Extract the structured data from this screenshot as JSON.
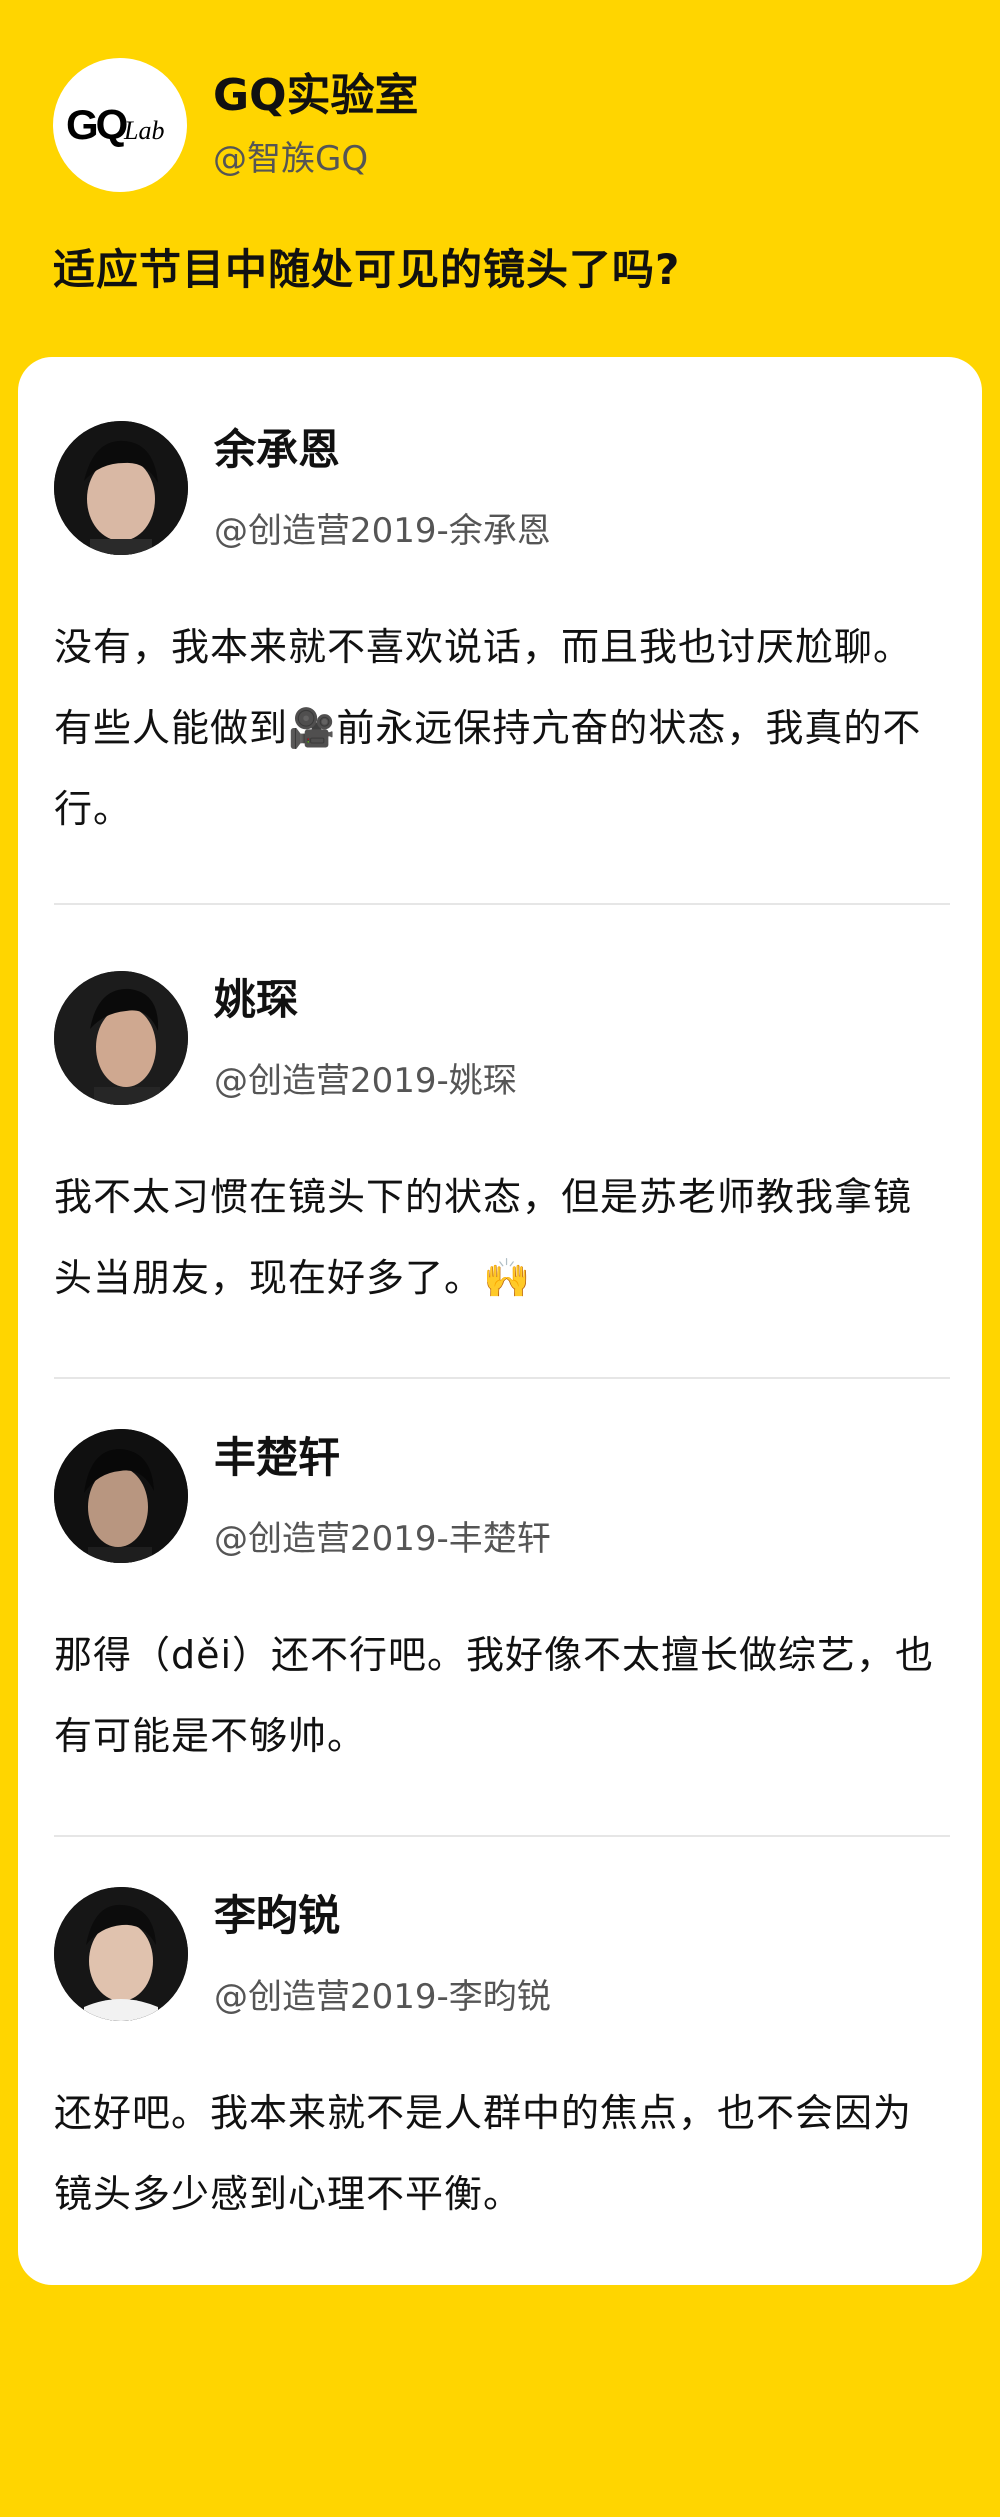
{
  "brand": {
    "logo_text": "GQLab",
    "name": "GQ实验室",
    "handle": "@智族GQ"
  },
  "question": "适应节目中随处可见的镜头了吗?",
  "entries": [
    {
      "name": "余承恩",
      "handle": "@创造营2019-余承恩",
      "answer": "没有，我本来就不喜欢说话，而且我也讨厌尬聊。有些人能做到🎥前永远保持亢奋的状态，我真的不行。"
    },
    {
      "name": "姚琛",
      "handle": "@创造营2019-姚琛",
      "answer": "我不太习惯在镜头下的状态，但是苏老师教我拿镜头当朋友，现在好多了。🙌"
    },
    {
      "name": "丰楚轩",
      "handle": "@创造营2019-丰楚轩",
      "answer": "那得（děi）还不行吧。我好像不太擅长做综艺，也有可能是不够帅。"
    },
    {
      "name": "李昀锐",
      "handle": "@创造营2019-李昀锐",
      "answer": "还好吧。我本来就不是人群中的焦点，也不会因为镜头多少感到心理不平衡。"
    }
  ],
  "colors": {
    "background": "#FFD500",
    "card": "#FFFFFF",
    "divider": "#E6E6E6"
  }
}
